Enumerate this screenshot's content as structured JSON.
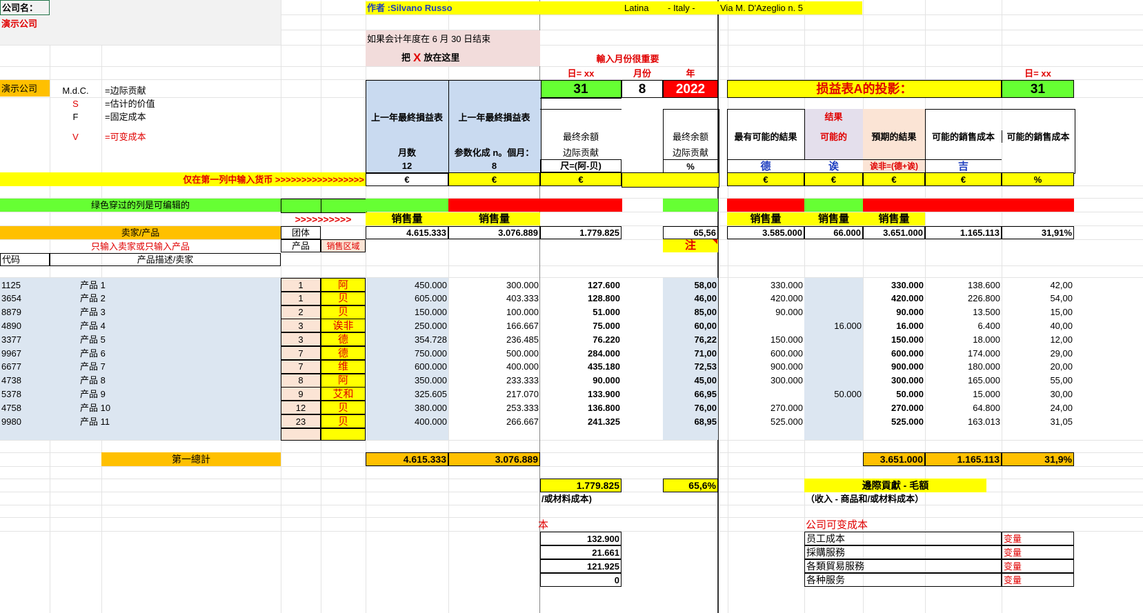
{
  "header": {
    "company_label": "公司名：",
    "company_name": "演示公司",
    "author": "作者 :Silvano Russo",
    "city": "Latina",
    "country": "- Italy -",
    "address": "Via M. D'Azeglio n. 5",
    "fiscal_note": "如果会计年度在 6 月 30 日结束",
    "x_note_prefix": "把",
    "x_note_x": "X",
    "x_note_suffix": "放在这里",
    "input_month_note": "輸入月份很重要",
    "day_label": "日= xx",
    "month_label": "月份",
    "year_label": "年",
    "day_value": "31",
    "month_value": "8",
    "year_value": "2022",
    "projection_title": "损益表A的投影：",
    "day_label_right": "日= xx",
    "day_value_right": "31"
  },
  "legend": {
    "company": "演示公司",
    "items": [
      {
        "key": "M.d.C.",
        "desc": "=边际贡献"
      },
      {
        "key": "S",
        "desc": "=估计的价值"
      },
      {
        "key": "F",
        "desc": "=固定成本"
      },
      {
        "key": "V",
        "desc": "=可变成本"
      }
    ]
  },
  "columns": {
    "prev_year_1": "上一年最終損益表",
    "prev_year_2": "上一年最終損益表",
    "months_label": "月数",
    "months_value": "12",
    "param_label": "参数化成 n。個月：",
    "param_value": "8",
    "final_balance_1": "最终余額",
    "margin_1": "边际贡献",
    "formula_1": "尺=(阿-贝)",
    "final_balance_2": "最终余额",
    "margin_2": "边际贡献",
    "percent": "%",
    "best_result": "最有可能的結果",
    "result_top": "结果",
    "possible": "可能的",
    "expected": "預期的結果",
    "possible_cost_1": "可能的銷售成本",
    "possible_cost_2": "可能的銷售成本",
    "code_de": "德",
    "code_ai": "诶",
    "code_formula": "诶非=(德+诶)",
    "code_ji": "吉",
    "currency_note": "仅在第一列中输入货币 >>>>>>>>>>>>>>>>>",
    "currency": "€",
    "pct_sign": "%",
    "editable_note": "绿色穿过的列是可编辑的",
    "arrows": ">>>>>>>>>>",
    "sales_volume": "销售量",
    "seller_product": "卖家/产品",
    "only_input_note": "只输入卖家或只输入产品",
    "group": "团体",
    "product": "产品",
    "sales_area": "销售区域",
    "code": "代码",
    "description": "产品描述/卖家",
    "note": "注"
  },
  "totals_top": {
    "prev_year": "4.615.333",
    "param": "3.076.889",
    "margin": "1.779.825",
    "margin_pct": "65,56",
    "best": "3.585.000",
    "possible": "66.000",
    "expected": "3.651.000",
    "cost": "1.165.113",
    "cost_pct": "31,91%"
  },
  "rows": [
    {
      "code": "1125",
      "name": "产品 1",
      "group": "1",
      "area": "阿",
      "prev": "450.000",
      "param": "300.000",
      "margin": "127.600",
      "pct": "58,00",
      "best": "330.000",
      "possible": "",
      "expected": "330.000",
      "cost": "138.600",
      "cost_pct": "42,00"
    },
    {
      "code": "3654",
      "name": "产品 2",
      "group": "1",
      "area": "贝",
      "prev": "605.000",
      "param": "403.333",
      "margin": "128.800",
      "pct": "46,00",
      "best": "420.000",
      "possible": "",
      "expected": "420.000",
      "cost": "226.800",
      "cost_pct": "54,00"
    },
    {
      "code": "8879",
      "name": "产品 3",
      "group": "2",
      "area": "贝",
      "prev": "150.000",
      "param": "100.000",
      "margin": "51.000",
      "pct": "85,00",
      "best": "90.000",
      "possible": "",
      "expected": "90.000",
      "cost": "13.500",
      "cost_pct": "15,00"
    },
    {
      "code": "4890",
      "name": "产品 4",
      "group": "3",
      "area": "诶非",
      "prev": "250.000",
      "param": "166.667",
      "margin": "75.000",
      "pct": "60,00",
      "best": "",
      "possible": "16.000",
      "expected": "16.000",
      "cost": "6.400",
      "cost_pct": "40,00"
    },
    {
      "code": "3377",
      "name": "产品 5",
      "group": "3",
      "area": "德",
      "prev": "354.728",
      "param": "236.485",
      "margin": "76.220",
      "pct": "76,22",
      "best": "150.000",
      "possible": "",
      "expected": "150.000",
      "cost": "18.000",
      "cost_pct": "12,00"
    },
    {
      "code": "9967",
      "name": "产品 6",
      "group": "7",
      "area": "德",
      "prev": "750.000",
      "param": "500.000",
      "margin": "284.000",
      "pct": "71,00",
      "best": "600.000",
      "possible": "",
      "expected": "600.000",
      "cost": "174.000",
      "cost_pct": "29,00"
    },
    {
      "code": "6677",
      "name": "产品 7",
      "group": "7",
      "area": "维",
      "prev": "600.000",
      "param": "400.000",
      "margin": "435.180",
      "pct": "72,53",
      "best": "900.000",
      "possible": "",
      "expected": "900.000",
      "cost": "180.000",
      "cost_pct": "20,00"
    },
    {
      "code": "4738",
      "name": "产品 8",
      "group": "8",
      "area": "阿",
      "prev": "350.000",
      "param": "233.333",
      "margin": "90.000",
      "pct": "45,00",
      "best": "300.000",
      "possible": "",
      "expected": "300.000",
      "cost": "165.000",
      "cost_pct": "55,00"
    },
    {
      "code": "5378",
      "name": "产品 9",
      "group": "9",
      "area": "艾和",
      "prev": "325.605",
      "param": "217.070",
      "margin": "133.900",
      "pct": "66,95",
      "best": "",
      "possible": "50.000",
      "expected": "50.000",
      "cost": "15.000",
      "cost_pct": "30,00"
    },
    {
      "code": "4758",
      "name": "产品 10",
      "group": "12",
      "area": "贝",
      "prev": "380.000",
      "param": "253.333",
      "margin": "136.800",
      "pct": "76,00",
      "best": "270.000",
      "possible": "",
      "expected": "270.000",
      "cost": "64.800",
      "cost_pct": "24,00"
    },
    {
      "code": "9980",
      "name": "产品 11",
      "group": "23",
      "area": "贝",
      "prev": "400.000",
      "param": "266.667",
      "margin": "241.325",
      "pct": "68,95",
      "best": "525.000",
      "possible": "",
      "expected": "525.000",
      "cost": "163.013",
      "cost_pct": "31,05"
    }
  ],
  "grand_total": {
    "label": "第一總計",
    "prev": "4.615.333",
    "param": "3.076.889",
    "expected": "3.651.000",
    "cost": "1.165.113",
    "cost_pct": "31,9%"
  },
  "margin_block": {
    "margin_total": "1.779.825",
    "margin_pct": "65,6%",
    "gross_title": "邊際貢獻 - 毛額",
    "left_note": "/或材料成本)",
    "right_note": "（收入 - 商品和/或材料成本）",
    "left_partial": "本",
    "variable_title": "公司可变成本",
    "values": [
      "132.900",
      "21.661",
      "121.925",
      "0"
    ],
    "var_items": [
      {
        "label": "员工成本",
        "tag": "变量"
      },
      {
        "label": "採購服務",
        "tag": "变量"
      },
      {
        "label": "各類貿易服務",
        "tag": "变量"
      },
      {
        "label": "各种服务",
        "tag": "变量"
      }
    ]
  }
}
